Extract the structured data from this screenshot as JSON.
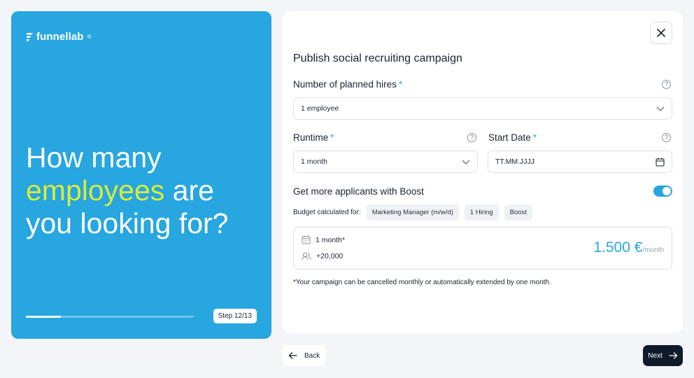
{
  "brand": {
    "name": "funnellab",
    "mark": "®"
  },
  "hero": {
    "headline_before": "How many ",
    "headline_highlight": "employees",
    "headline_after": " are you looking for?",
    "progress": 0.21,
    "step_label": "Step 12/13"
  },
  "form": {
    "title": "Publish social recruiting campaign",
    "hires": {
      "label": "Number of planned hires",
      "required_mark": "*",
      "value": "1 employee"
    },
    "runtime": {
      "label": "Runtime",
      "required_mark": "*",
      "value": "1 month"
    },
    "start_date": {
      "label": "Start Date",
      "required_mark": "*",
      "placeholder": "TT.MM.JJJJ"
    },
    "help_glyph": "?",
    "boost": {
      "label": "Get more applicants with Boost",
      "enabled": true
    },
    "budget": {
      "label": "Budget calculated for:",
      "chips": [
        "Marketing Manager (m/w/d)",
        "1 Hiring",
        "Boost"
      ]
    },
    "summary": {
      "duration": "1 month*",
      "reach": "+20,000",
      "price": "1.500 €",
      "price_unit": "/month"
    },
    "footnote": "*Your campaign can be cancelled monthly or automatically extended by one month."
  },
  "nav": {
    "back_label": "Back",
    "next_label": "Next"
  },
  "colors": {
    "accent": "#27a6e0",
    "highlight": "#d8ec3a",
    "dark": "#0f1b2b"
  }
}
